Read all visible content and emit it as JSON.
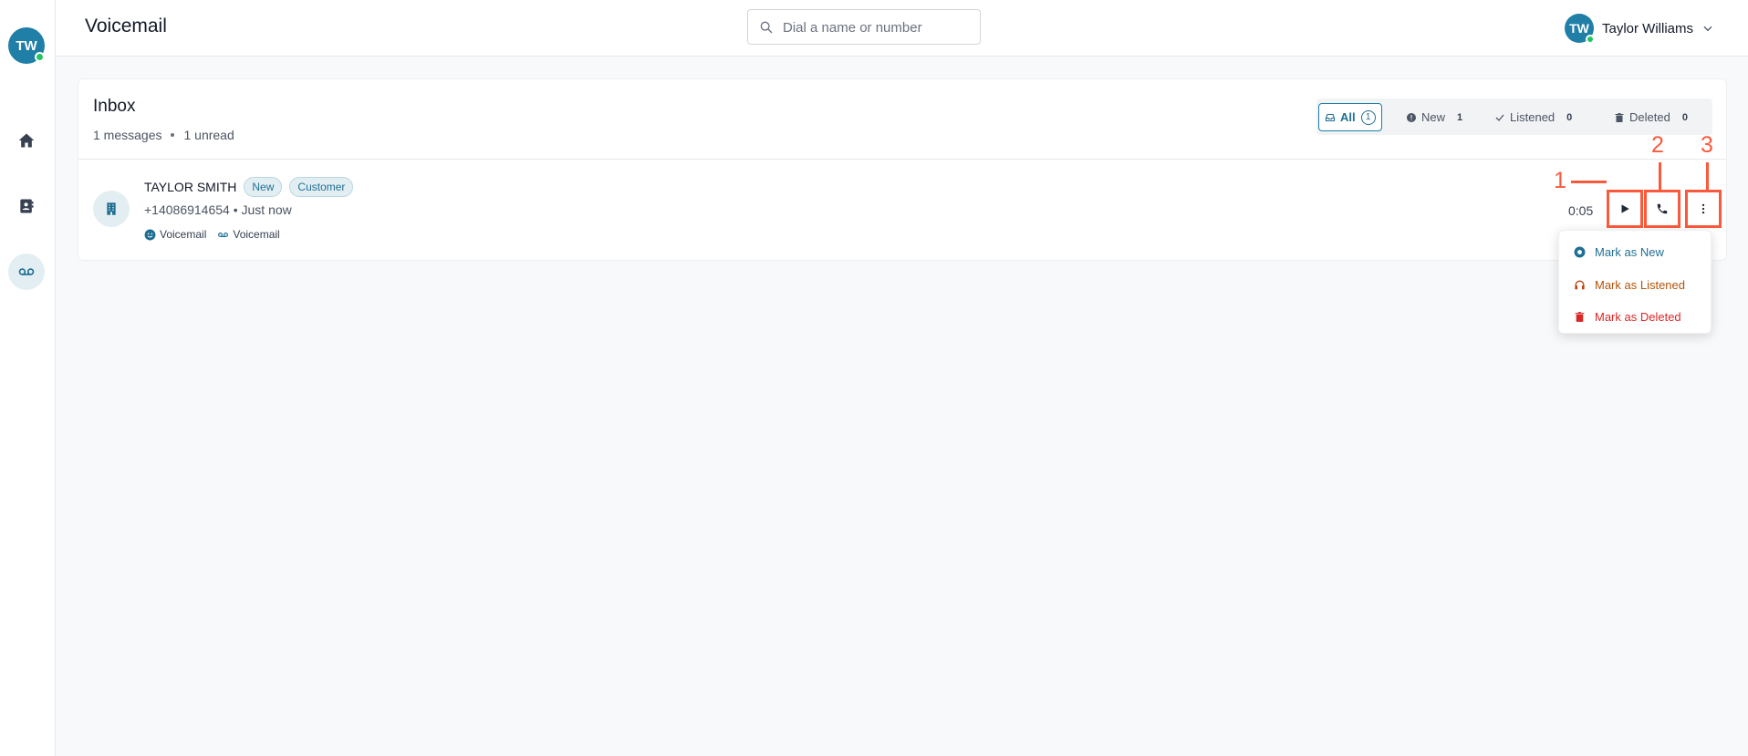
{
  "sidebar": {
    "avatar_initials": "TW",
    "nav": [
      {
        "name": "home",
        "icon": "home-icon"
      },
      {
        "name": "contacts",
        "icon": "contacts-icon"
      },
      {
        "name": "voicemail",
        "icon": "voicemail-icon",
        "active": true
      }
    ]
  },
  "header": {
    "title": "Voicemail",
    "search_placeholder": "Dial a name or number",
    "user_initials": "TW",
    "user_name": "Taylor Williams"
  },
  "inbox": {
    "title": "Inbox",
    "message_count": "1 messages",
    "unread_count": "1 unread",
    "filters": [
      {
        "label": "All",
        "count": "1",
        "icon": "inbox-icon",
        "active": true
      },
      {
        "label": "New",
        "count": "1",
        "icon": "info-circle-icon"
      },
      {
        "label": "Listened",
        "count": "0",
        "icon": "check-icon"
      },
      {
        "label": "Deleted",
        "count": "0",
        "icon": "trash-icon"
      }
    ],
    "message": {
      "caller_name": "TAYLOR SMITH",
      "badges": [
        "New",
        "Customer"
      ],
      "meta": "+14086914654 • Just now",
      "tags": [
        "Voicemail",
        "Voicemail"
      ],
      "duration": "0:05"
    }
  },
  "annotations": [
    "1",
    "2",
    "3"
  ],
  "menu": {
    "items": [
      {
        "label": "Mark as New",
        "icon": "radio-dot-icon",
        "color": "#1f6f92"
      },
      {
        "label": "Mark as Listened",
        "icon": "headphones-icon",
        "color": "#b45309"
      },
      {
        "label": "Mark as Deleted",
        "icon": "trash-icon",
        "color": "#dc2626"
      }
    ]
  },
  "colors": {
    "accent": "#1f7fa6",
    "annotation": "#fa5a3c",
    "online": "#22c55e"
  }
}
